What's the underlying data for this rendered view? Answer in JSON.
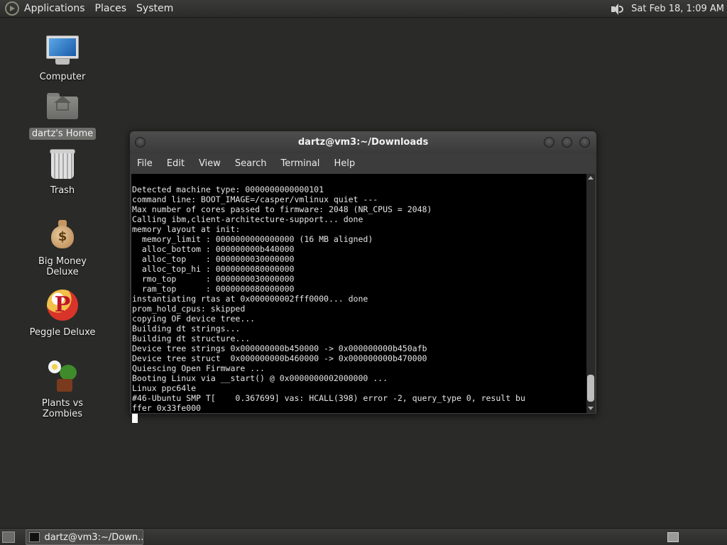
{
  "top_panel": {
    "menus": [
      "Applications",
      "Places",
      "System"
    ],
    "clock": "Sat Feb 18,  1:09 AM",
    "icons": {
      "menu": "gnome-foot-icon",
      "volume": "volume-icon"
    }
  },
  "desktop_icons": [
    {
      "label": "Computer",
      "icon": "computer-icon"
    },
    {
      "label": "dartz's Home",
      "icon": "home-folder-icon",
      "selected": true
    },
    {
      "label": "Trash",
      "icon": "trash-icon"
    },
    {
      "label": "Big Money Deluxe",
      "icon": "money-bag-icon"
    },
    {
      "label": "Peggle Deluxe",
      "icon": "peggle-icon"
    },
    {
      "label": "Plants vs Zombies",
      "icon": "plants-vs-zombies-icon"
    }
  ],
  "terminal": {
    "title": "dartz@vm3:~/Downloads",
    "menu": [
      "File",
      "Edit",
      "View",
      "Search",
      "Terminal",
      "Help"
    ],
    "lines": [
      "Detected machine type: 0000000000000101",
      "command line: BOOT_IMAGE=/casper/vmlinux quiet ---",
      "Max number of cores passed to firmware: 2048 (NR_CPUS = 2048)",
      "Calling ibm,client-architecture-support... done",
      "memory layout at init:",
      "  memory_limit : 0000000000000000 (16 MB aligned)",
      "  alloc_bottom : 000000000b440000",
      "  alloc_top    : 0000000030000000",
      "  alloc_top_hi : 0000000080000000",
      "  rmo_top      : 0000000030000000",
      "  ram_top      : 0000000080000000",
      "instantiating rtas at 0x000000002fff0000... done",
      "prom_hold_cpus: skipped",
      "copying OF device tree...",
      "Building dt strings...",
      "Building dt structure...",
      "Device tree strings 0x000000000b450000 -> 0x000000000b450afb",
      "Device tree struct  0x000000000b460000 -> 0x000000000b470000",
      "Quiescing Open Firmware ...",
      "Booting Linux via __start() @ 0x0000000002000000 ...",
      "Linux ppc64le",
      "#46-Ubuntu SMP T[    0.367699] vas: HCALL(398) error -2, query_type 0, result bu",
      "ffer 0x33fe000"
    ]
  },
  "bottom_panel": {
    "task": "dartz@vm3:~/Down...",
    "icons": {
      "show_desktop": "show-desktop-icon",
      "workspace": "workspace-switcher-icon"
    }
  }
}
